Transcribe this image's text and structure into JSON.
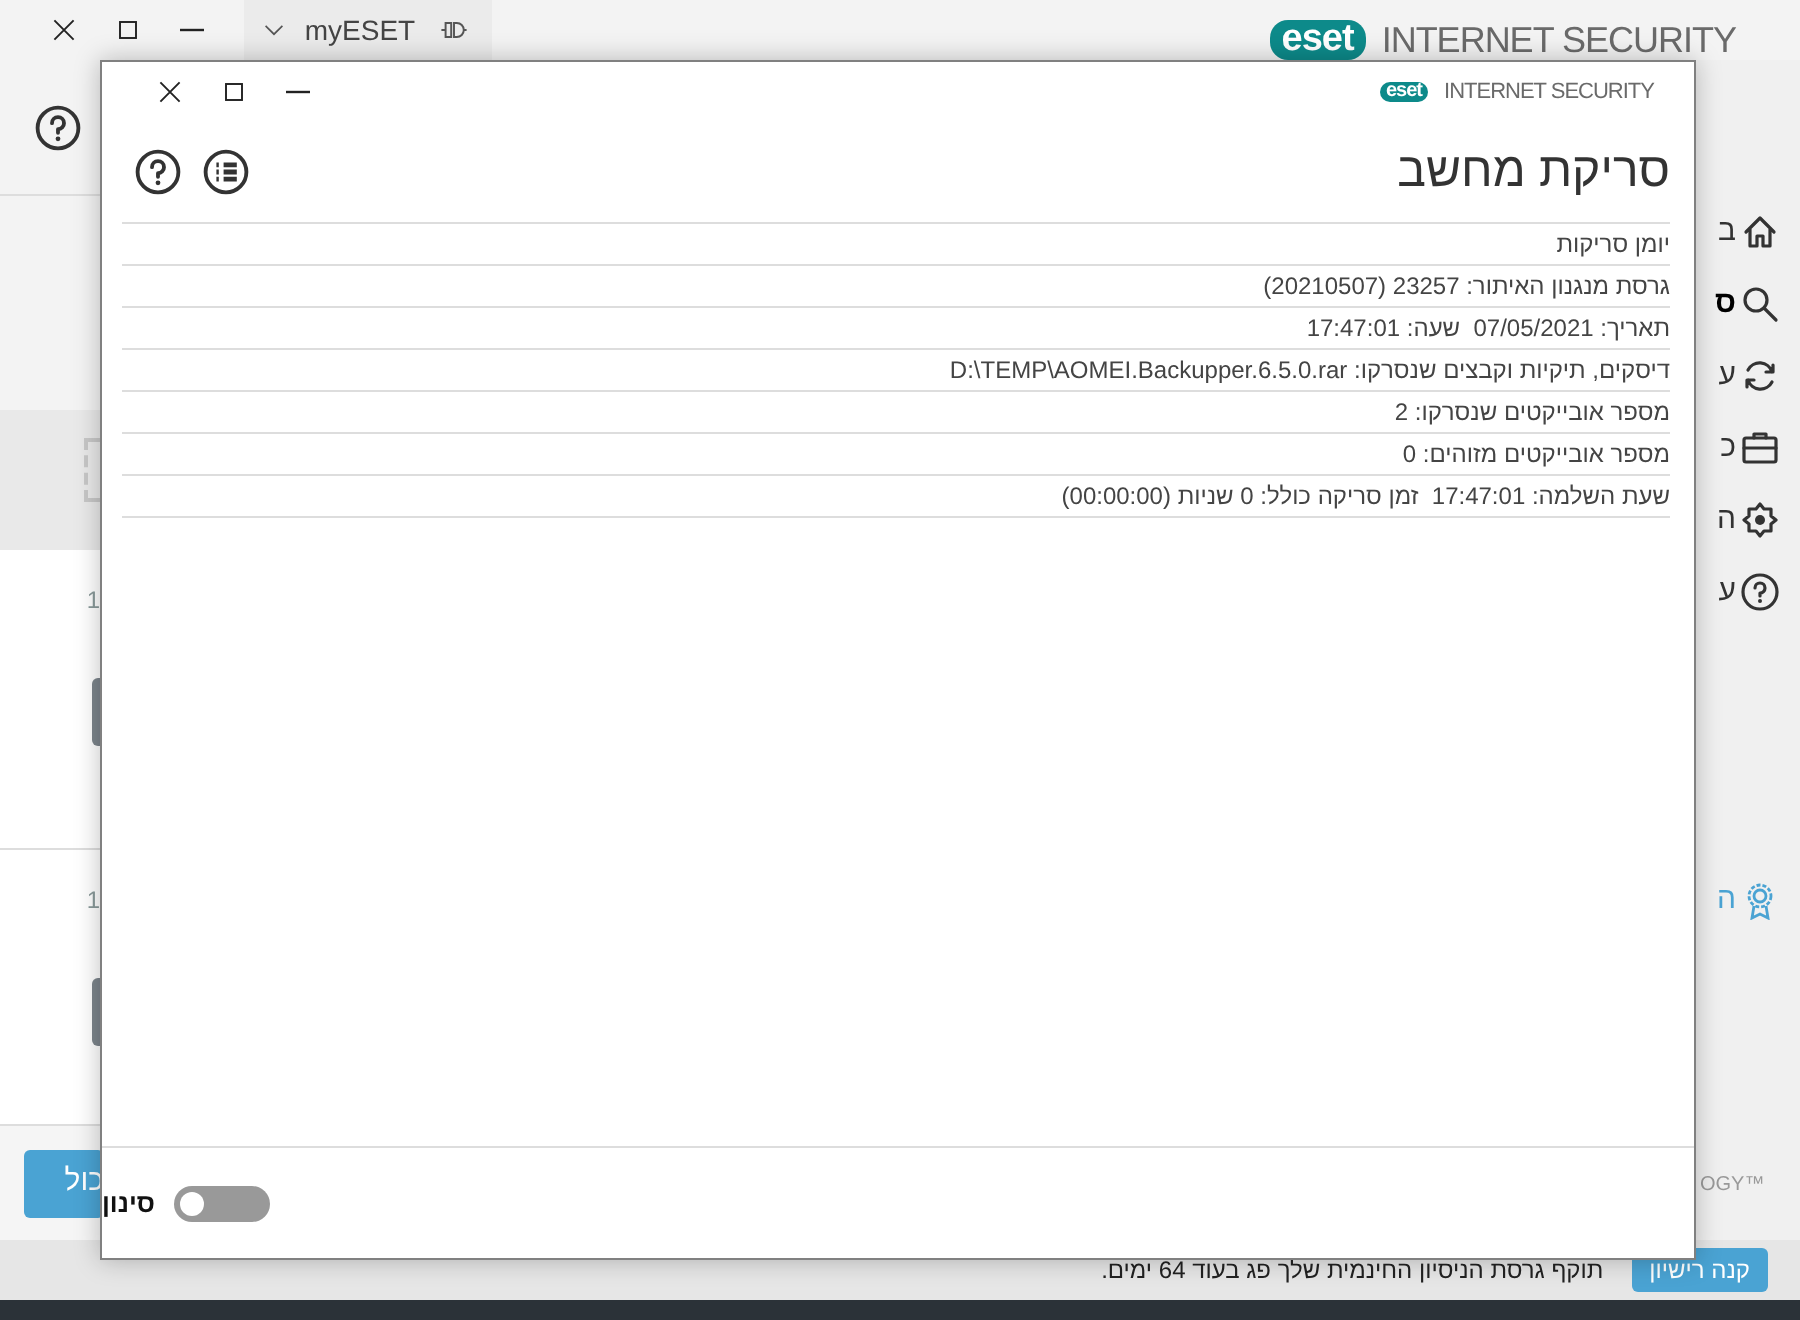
{
  "app_window": {
    "tab": {
      "label": "myESET"
    },
    "logo": {
      "mark": "eset",
      "product": "INTERNET SECURITY"
    },
    "sidebar": [
      {
        "label": "ב",
        "selected": false
      },
      {
        "label": "ס",
        "selected": true
      },
      {
        "label": "ע",
        "selected": false
      },
      {
        "label": "כ",
        "selected": false
      },
      {
        "label": "ה",
        "selected": false
      },
      {
        "label": "ע",
        "selected": false
      }
    ],
    "promo": {
      "label": "ה"
    },
    "left_panel": {
      "rows": [
        {
          "text": "1"
        },
        {
          "text": "1"
        }
      ],
      "button": "כול"
    },
    "footer_mark": "OGY™",
    "status_bar": {
      "button": "קנה רישיון",
      "message": "תוקף גרסת הניסיון החינמית שלך פג בעוד 64 ימים."
    }
  },
  "dialog": {
    "logo": {
      "mark": "eset",
      "product": "INTERNET SECURITY"
    },
    "title": "סריקת מחשב",
    "log_lines": [
      "יומן סריקות",
      "גרסת מנגנון האיתור: 23257 (20210507)",
      "תאריך: 07/05/2021  שעה: 17:47:01",
      "דיסקים, תיקיות וקבצים שנסרקו: D:\\TEMP\\AOMEI.Backupper.6.5.0.rar",
      "מספר אובייקטים שנסרקו: 2",
      "מספר אובייקטים מזוהים: 0",
      "שעת השלמה: 17:47:01  זמן סריקה כולל: 0 שניות (00:00:00)"
    ],
    "filter": {
      "label": "סינון",
      "on": false
    }
  }
}
